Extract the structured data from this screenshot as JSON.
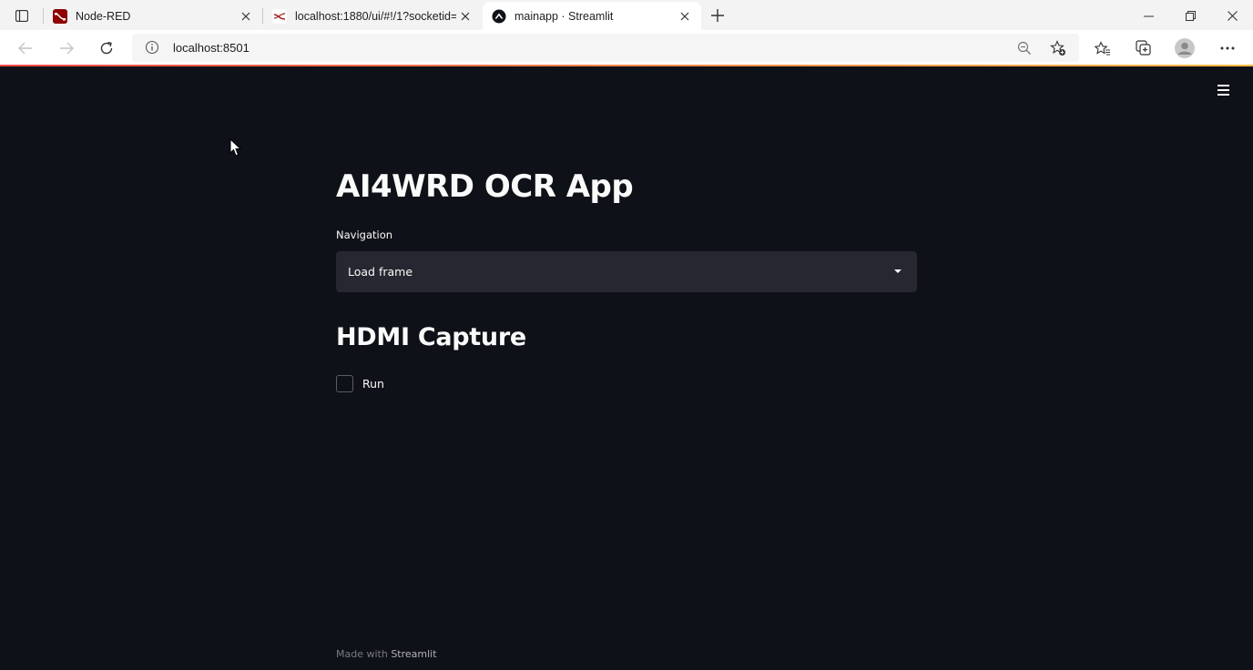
{
  "browser": {
    "tabs": [
      {
        "title": "Node-RED",
        "favicon": "node-red-icon",
        "active": false
      },
      {
        "title": "localhost:1880/ui/#!/1?socketid=",
        "favicon": "node-red-dashboard-icon",
        "active": false
      },
      {
        "title": "mainapp · Streamlit",
        "favicon": "streamlit-icon",
        "active": true
      }
    ],
    "address": "localhost:8501"
  },
  "app": {
    "title": "AI4WRD OCR App",
    "navigation": {
      "label": "Navigation",
      "selected": "Load frame"
    },
    "section_title": "HDMI Capture",
    "run_checkbox": {
      "label": "Run",
      "checked": false
    },
    "footer": {
      "prefix": "Made with",
      "brand": "Streamlit"
    }
  },
  "colors": {
    "background": "#0e1117",
    "select_bg": "#262730",
    "text": "#fafafa",
    "accent_red": "#ff4b4b",
    "node_red": "#8f0000"
  }
}
